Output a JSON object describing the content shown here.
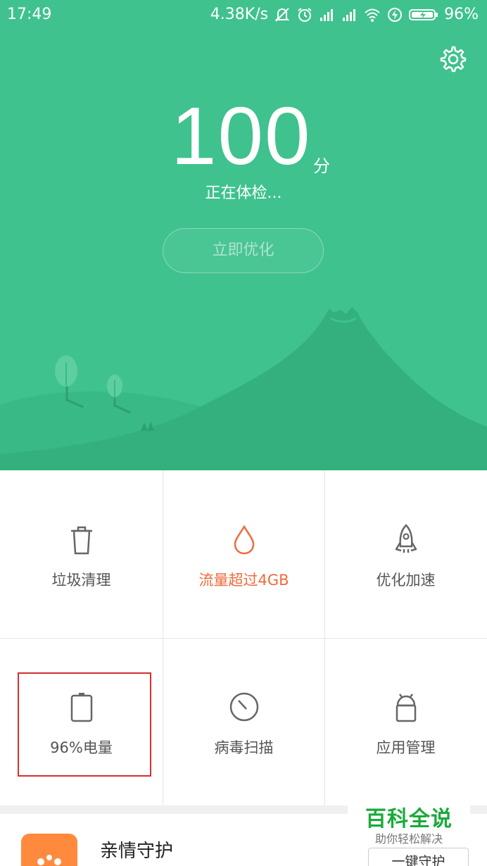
{
  "status_bar": {
    "time": "17:49",
    "speed": "4.38K/s",
    "battery": "96%",
    "icons": [
      "mute-icon",
      "alarm-icon",
      "signal-icon",
      "signal-icon",
      "wifi-icon",
      "charging-icon",
      "battery-icon"
    ]
  },
  "hero": {
    "score": "100",
    "score_unit": "分",
    "status": "正在体检...",
    "optimize_label": "立即优化",
    "colors": {
      "hero_bg": "#3fc28e",
      "hill": "#33b07e"
    }
  },
  "grid": {
    "items": [
      {
        "label": "垃圾清理",
        "icon": "trash-icon"
      },
      {
        "label": "流量超过4GB",
        "icon": "drop-icon",
        "color": "#f06a3c"
      },
      {
        "label": "优化加速",
        "icon": "rocket-icon"
      },
      {
        "label": "96%电量",
        "icon": "battery-icon"
      },
      {
        "label": "病毒扫描",
        "icon": "scan-icon"
      },
      {
        "label": "应用管理",
        "icon": "android-icon"
      }
    ]
  },
  "card": {
    "title": "亲情守护",
    "icon": "family-icon"
  },
  "watermark": {
    "title": "百科全说",
    "subtitle": "助你轻松解决",
    "button": "一键守护"
  }
}
